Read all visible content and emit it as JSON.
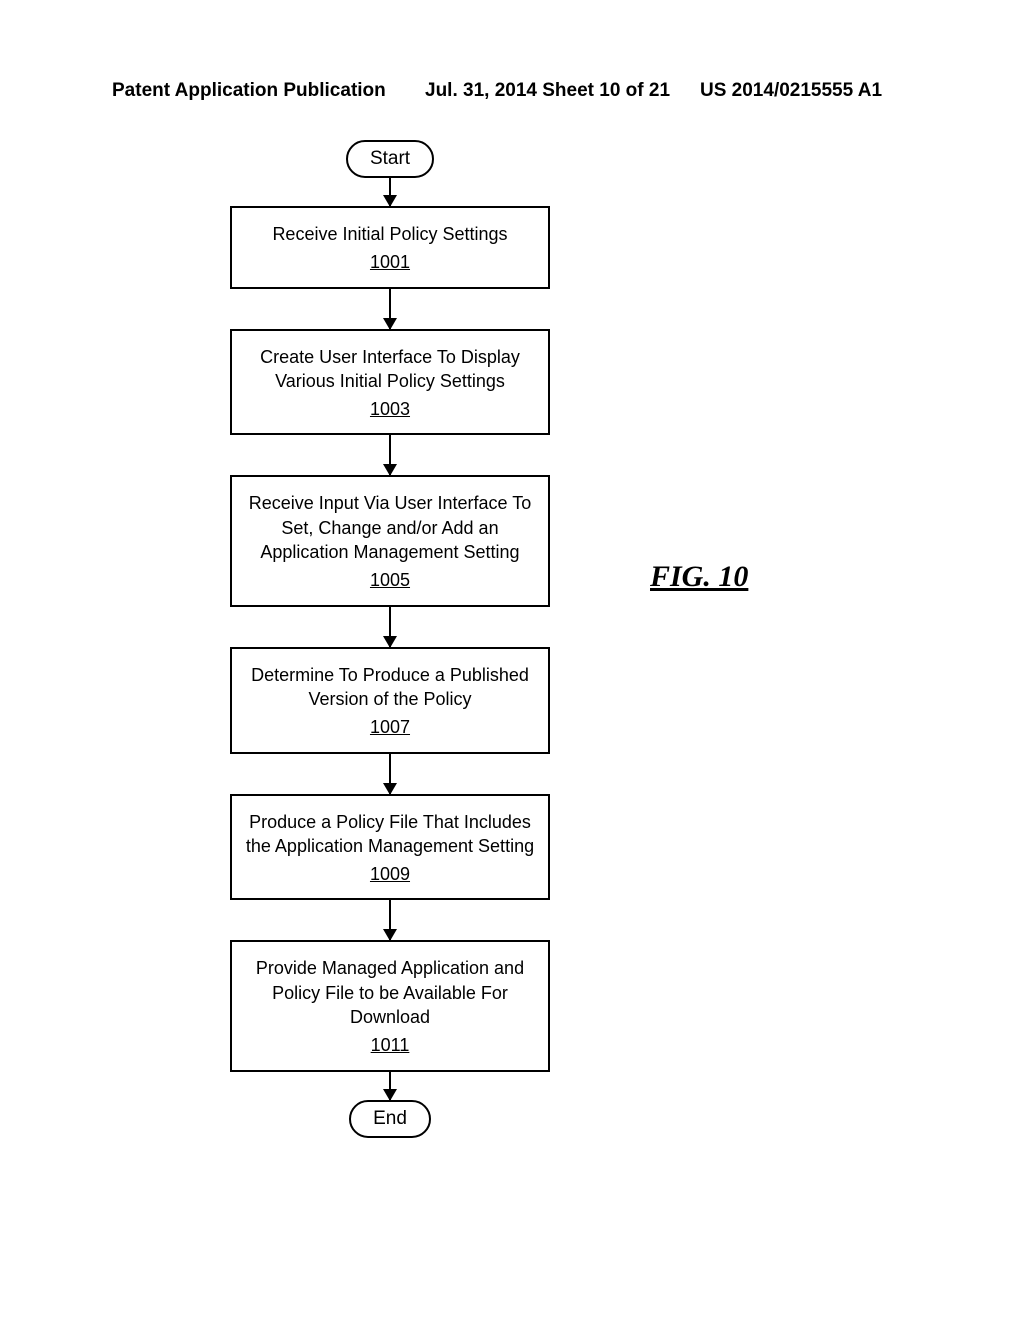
{
  "header": {
    "left": "Patent Application Publication",
    "mid": "Jul. 31, 2014  Sheet 10 of 21",
    "right": "US 2014/0215555 A1"
  },
  "figure_label": "FIG. 10",
  "flow": {
    "start": "Start",
    "end": "End",
    "steps": [
      {
        "text": "Receive Initial Policy Settings",
        "ref": "1001"
      },
      {
        "text": "Create User Interface To Display Various Initial Policy Settings",
        "ref": "1003"
      },
      {
        "text": "Receive Input Via User Interface To Set, Change and/or Add an Application Management Setting",
        "ref": "1005"
      },
      {
        "text": "Determine To Produce a Published Version of the Policy",
        "ref": "1007"
      },
      {
        "text": "Produce a Policy File That Includes the Application Management Setting",
        "ref": "1009"
      },
      {
        "text": "Provide Managed Application and Policy File to be Available For Download",
        "ref": "1011"
      }
    ]
  },
  "chart_data": {
    "type": "flowchart",
    "title": "FIG. 10",
    "nodes": [
      {
        "id": "start",
        "shape": "terminator",
        "label": "Start"
      },
      {
        "id": "1001",
        "shape": "process",
        "label": "Receive Initial Policy Settings",
        "ref": "1001"
      },
      {
        "id": "1003",
        "shape": "process",
        "label": "Create User Interface To Display Various Initial Policy Settings",
        "ref": "1003"
      },
      {
        "id": "1005",
        "shape": "process",
        "label": "Receive Input Via User Interface To Set, Change and/or Add an Application Management Setting",
        "ref": "1005"
      },
      {
        "id": "1007",
        "shape": "process",
        "label": "Determine To Produce a Published Version of the Policy",
        "ref": "1007"
      },
      {
        "id": "1009",
        "shape": "process",
        "label": "Produce a Policy File That Includes the Application Management Setting",
        "ref": "1009"
      },
      {
        "id": "1011",
        "shape": "process",
        "label": "Provide Managed Application and Policy File to be Available For Download",
        "ref": "1011"
      },
      {
        "id": "end",
        "shape": "terminator",
        "label": "End"
      }
    ],
    "edges": [
      [
        "start",
        "1001"
      ],
      [
        "1001",
        "1003"
      ],
      [
        "1003",
        "1005"
      ],
      [
        "1005",
        "1007"
      ],
      [
        "1007",
        "1009"
      ],
      [
        "1009",
        "1011"
      ],
      [
        "1011",
        "end"
      ]
    ]
  }
}
